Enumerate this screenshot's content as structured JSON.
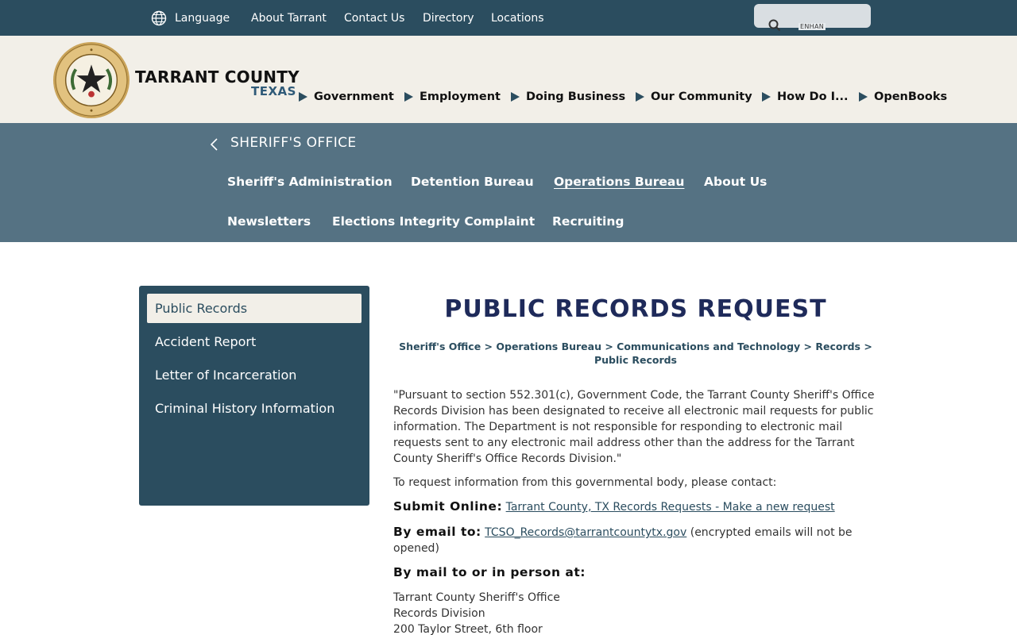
{
  "topbar": {
    "language": "Language",
    "links": [
      "About Tarrant",
      "Contact Us",
      "Directory",
      "Locations"
    ],
    "search_enhanced": "ENHAN"
  },
  "header": {
    "brand_title": "TARRANT COUNTY",
    "brand_sub": "TEXAS",
    "nav": [
      "Government",
      "Employment",
      "Doing Business",
      "Our Community",
      "How Do I...",
      "OpenBooks"
    ]
  },
  "subbanner": {
    "department": "SHERIFF'S OFFICE",
    "row1": [
      "Sheriff's Administration",
      "Detention Bureau",
      "Operations Bureau",
      "About Us"
    ],
    "row2": [
      "Newsletters",
      "Elections Integrity Complaint",
      "Recruiting"
    ]
  },
  "sidebar": {
    "items": [
      "Public Records",
      "Accident Report",
      "Letter of Incarceration",
      "Criminal History Information"
    ]
  },
  "main": {
    "title": "PUBLIC RECORDS REQUEST",
    "breadcrumb_line1": "Sheriff's Office > Operations Bureau > Communications and Technology > Records >",
    "breadcrumb_line2": "Public Records",
    "quote": "\"Pursuant to section 552.301(c), Government Code, the Tarrant County Sheriff's Office Records Division has been designated to receive all electronic mail requests for public information. The Department is not responsible for responding to electronic mail requests sent to any electronic mail address other than the address for the Tarrant County Sheriff's Office Records Division.\"",
    "request_info": "To request information from this governmental body, please contact:",
    "online_label": "Submit Online:",
    "online_link": "Tarrant County, TX Records Requests - Make a new request",
    "email_label": "By email to:",
    "email_link": "TCSO_Records@tarrantcountytx.gov",
    "email_note": "(encrypted emails will not be opened)",
    "mail_label": "By mail to or in person at:",
    "address": [
      "Tarrant County Sheriff's Office",
      "Records Division",
      "200 Taylor Street, 6th floor"
    ]
  },
  "colors": {
    "topbar": "#2b4d5f",
    "header_bg": "#f2efe8",
    "subbanner": "#557283",
    "title": "#1e2a5a"
  }
}
